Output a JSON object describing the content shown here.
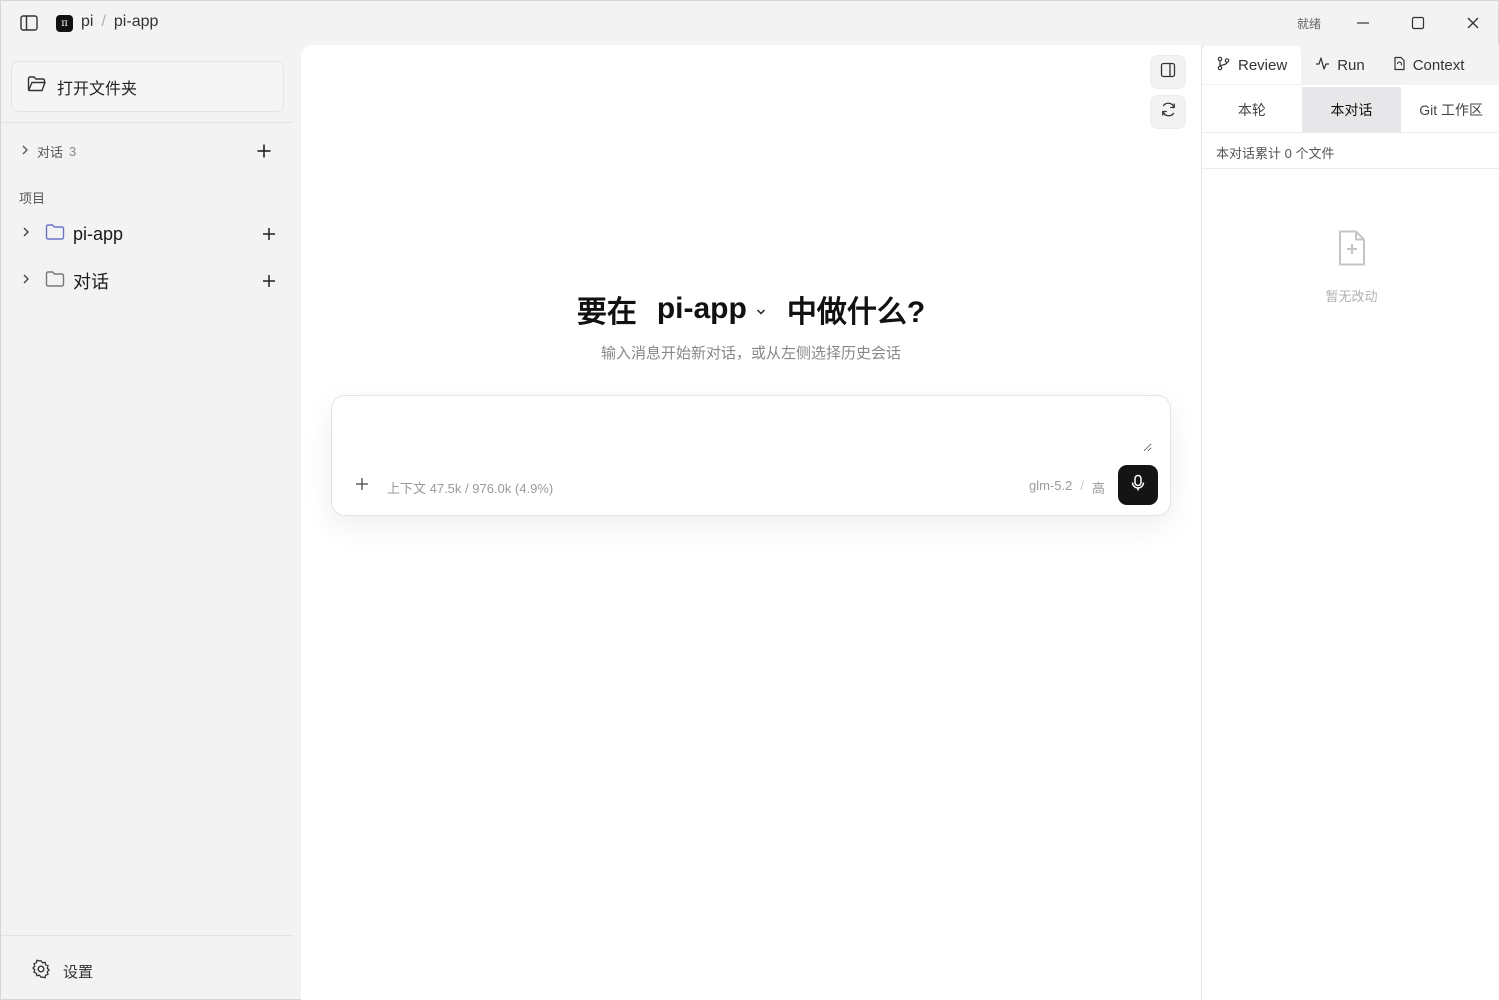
{
  "titlebar": {
    "app_icon_glyph": "π",
    "breadcrumb": [
      "pi",
      "pi-app"
    ],
    "separator": "/",
    "status": "就绪"
  },
  "sidebar": {
    "open_folder_label": "打开文件夹",
    "conversations": {
      "label": "对话",
      "count": "3"
    },
    "projects_heading": "项目",
    "projects": [
      {
        "label": "pi-app",
        "icon": "folder-icon",
        "icon_color": "#6b74c9"
      },
      {
        "label": "对话",
        "icon": "folder-icon",
        "icon_color": "#777777"
      }
    ],
    "settings_label": "设置"
  },
  "main": {
    "hero_prefix": "要在",
    "hero_project": "pi-app",
    "hero_suffix": "中做什么?",
    "subtitle": "输入消息开始新对话，或从左侧选择历史会话",
    "composer": {
      "placeholder": "",
      "context": "上下文 47.5k / 976.0k (4.9%)",
      "model": "glm-5.2",
      "separator": "/",
      "effort": "高"
    }
  },
  "right_panel": {
    "tabs": [
      {
        "label": "Review",
        "icon": "git-branch-icon"
      },
      {
        "label": "Run",
        "icon": "activity-icon"
      },
      {
        "label": "Context",
        "icon": "file-icon"
      }
    ],
    "segments": [
      "本轮",
      "本对话",
      "Git 工作区"
    ],
    "active_segment": "本对话",
    "summary": "本对话累计 0 个文件",
    "empty_text": "暂无改动"
  },
  "colors": {
    "accent_dark": "#141414",
    "sidebar_bg": "#f3f3f3",
    "folder_project": "#6b74c9"
  }
}
